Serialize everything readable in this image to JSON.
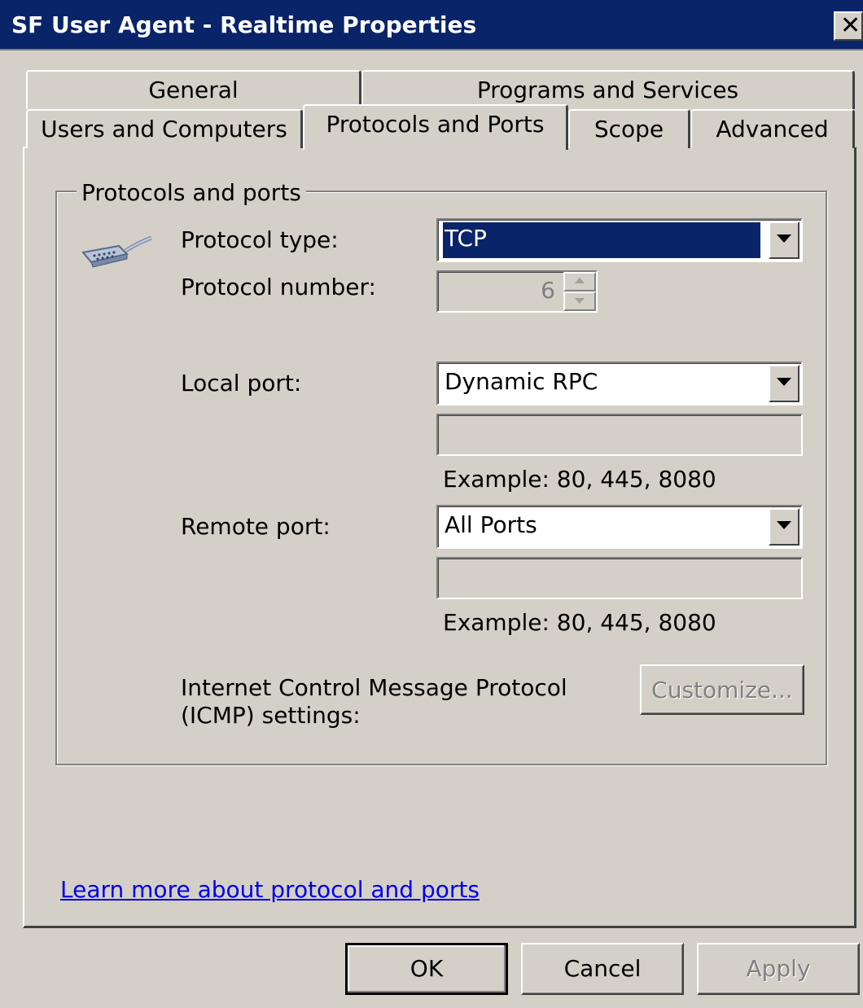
{
  "window": {
    "title": "SF User Agent - Realtime Properties",
    "close_glyph": "✕"
  },
  "tabs": {
    "row1": [
      {
        "label": "General"
      },
      {
        "label": "Programs and Services"
      }
    ],
    "row2": [
      {
        "label": "Users and Computers"
      },
      {
        "label": "Protocols and Ports",
        "active": true
      },
      {
        "label": "Scope"
      },
      {
        "label": "Advanced"
      }
    ]
  },
  "group": {
    "title": "Protocols and ports",
    "icon": "serial-cable-icon"
  },
  "protocol_type": {
    "label": "Protocol type:",
    "value": "TCP"
  },
  "protocol_number": {
    "label": "Protocol number:",
    "value": "6"
  },
  "local_port": {
    "label": "Local port:",
    "value": "Dynamic RPC",
    "text": "",
    "example": "Example: 80, 445, 8080"
  },
  "remote_port": {
    "label": "Remote port:",
    "value": "All Ports",
    "text": "",
    "example": "Example: 80, 445, 8080"
  },
  "icmp": {
    "label_line1": "Internet Control Message Protocol",
    "label_line2": "(ICMP) settings:",
    "customize_label": "Customize..."
  },
  "learn_more": {
    "label": "Learn more about protocol and ports"
  },
  "footer": {
    "ok_label": "OK",
    "cancel_label": "Cancel",
    "apply_label": "Apply"
  },
  "colors": {
    "face": "#d4d0c8",
    "titlebar": "#0a246a",
    "selection": "#0a246a",
    "link": "#0000ee",
    "disabled_text": "#808080"
  }
}
